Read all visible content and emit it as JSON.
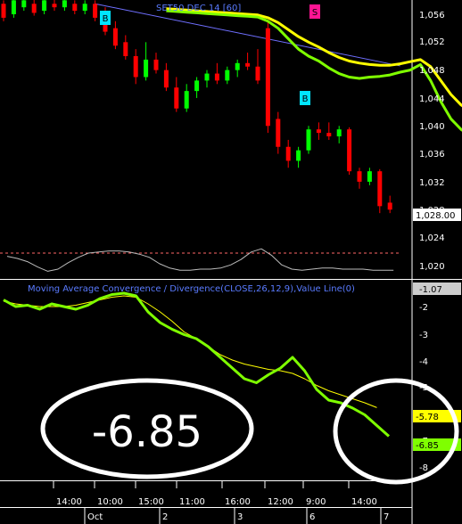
{
  "price_panel": {
    "title": "SET50 DEC 14  [60]",
    "y_ticks": [
      "1,056",
      "1,052",
      "1,048",
      "1,044",
      "1,040",
      "1,036",
      "1,032",
      "1,028",
      "1,024",
      "1,020"
    ],
    "last_value_label": "1,028.00",
    "markers": [
      {
        "text": "B",
        "kind": "buy",
        "color": "#00e5ff",
        "bar": 9
      },
      {
        "text": "B",
        "kind": "buy",
        "color": "#00e5ff",
        "bar": 25
      },
      {
        "text": "S",
        "kind": "sell",
        "color": "#ff1493",
        "bar": 26
      }
    ]
  },
  "oscillator_panel": {
    "value_label": "-1.07"
  },
  "macd_panel": {
    "title": "Moving Average Convergence / Divergence(CLOSE,26,12,9),Value Line(0)",
    "y_ticks": [
      "-2",
      "-3",
      "-4",
      "-5",
      "-6",
      "-7",
      "-8"
    ],
    "signal_label": "-5.78",
    "macd_label": "-6.85",
    "callout_text": "-6.85",
    "signal_color": "#ffff00",
    "macd_color": "#7fff00"
  },
  "time_axis": {
    "time_labels": [
      "14:00",
      "10:00",
      "15:00",
      "11:00",
      "16:00",
      "12:00",
      "9:00",
      "14:00"
    ],
    "date_labels": [
      "Oct",
      "2",
      "3",
      "6",
      "7"
    ]
  },
  "colors": {
    "up_candle": "#00ff00",
    "down_candle": "#ff0000",
    "ma_fast": "#7fff00",
    "ma_slow": "#ffff00",
    "trendline": "#6f6fff",
    "annotation": "#ffffff"
  },
  "chart_data": {
    "type": "candlestick",
    "bars": [
      {
        "o": 1057.5,
        "h": 1058.0,
        "l": 1055.0,
        "c": 1055.5
      },
      {
        "o": 1056.0,
        "h": 1058.5,
        "l": 1055.5,
        "c": 1058.0
      },
      {
        "o": 1057.0,
        "h": 1058.5,
        "l": 1056.5,
        "c": 1058.0
      },
      {
        "o": 1057.5,
        "h": 1058.5,
        "l": 1055.8,
        "c": 1056.2
      },
      {
        "o": 1056.5,
        "h": 1058.3,
        "l": 1056.0,
        "c": 1058.0
      },
      {
        "o": 1057.5,
        "h": 1058.5,
        "l": 1056.5,
        "c": 1057.0
      },
      {
        "o": 1057.0,
        "h": 1058.3,
        "l": 1056.5,
        "c": 1058.0
      },
      {
        "o": 1057.5,
        "h": 1058.0,
        "l": 1056.0,
        "c": 1056.5
      },
      {
        "o": 1056.5,
        "h": 1058.0,
        "l": 1056.0,
        "c": 1057.5
      },
      {
        "o": 1057.5,
        "h": 1058.0,
        "l": 1055.0,
        "c": 1055.5
      },
      {
        "o": 1056.0,
        "h": 1057.0,
        "l": 1053.0,
        "c": 1053.5
      },
      {
        "o": 1054.0,
        "h": 1055.0,
        "l": 1051.0,
        "c": 1051.5
      },
      {
        "o": 1052.0,
        "h": 1053.0,
        "l": 1049.5,
        "c": 1050.0
      },
      {
        "o": 1050.0,
        "h": 1051.0,
        "l": 1046.0,
        "c": 1047.0
      },
      {
        "o": 1047.0,
        "h": 1052.0,
        "l": 1046.5,
        "c": 1049.5
      },
      {
        "o": 1049.5,
        "h": 1050.5,
        "l": 1047.5,
        "c": 1048.0
      },
      {
        "o": 1048.0,
        "h": 1049.0,
        "l": 1045.0,
        "c": 1045.5
      },
      {
        "o": 1045.5,
        "h": 1047.0,
        "l": 1042.0,
        "c": 1042.5
      },
      {
        "o": 1042.5,
        "h": 1046.0,
        "l": 1042.0,
        "c": 1045.0
      },
      {
        "o": 1045.0,
        "h": 1047.0,
        "l": 1044.0,
        "c": 1046.5
      },
      {
        "o": 1046.5,
        "h": 1048.0,
        "l": 1045.5,
        "c": 1047.5
      },
      {
        "o": 1047.5,
        "h": 1049.0,
        "l": 1046.0,
        "c": 1046.5
      },
      {
        "o": 1046.5,
        "h": 1048.5,
        "l": 1046.0,
        "c": 1048.0
      },
      {
        "o": 1048.0,
        "h": 1049.5,
        "l": 1047.0,
        "c": 1049.0
      },
      {
        "o": 1049.0,
        "h": 1050.5,
        "l": 1048.0,
        "c": 1048.5
      },
      {
        "o": 1048.5,
        "h": 1051.0,
        "l": 1046.0,
        "c": 1046.5
      },
      {
        "o": 1054.0,
        "h": 1055.0,
        "l": 1039.0,
        "c": 1040.0
      },
      {
        "o": 1041.0,
        "h": 1042.0,
        "l": 1036.0,
        "c": 1037.0
      },
      {
        "o": 1037.0,
        "h": 1038.0,
        "l": 1034.0,
        "c": 1035.0
      },
      {
        "o": 1035.0,
        "h": 1037.0,
        "l": 1034.0,
        "c": 1036.5
      },
      {
        "o": 1036.5,
        "h": 1040.0,
        "l": 1036.0,
        "c": 1039.5
      },
      {
        "o": 1039.5,
        "h": 1040.5,
        "l": 1038.0,
        "c": 1039.0
      },
      {
        "o": 1039.0,
        "h": 1040.5,
        "l": 1038.0,
        "c": 1038.5
      },
      {
        "o": 1038.5,
        "h": 1040.0,
        "l": 1037.5,
        "c": 1039.5
      },
      {
        "o": 1039.5,
        "h": 1039.8,
        "l": 1033.0,
        "c": 1033.5
      },
      {
        "o": 1033.5,
        "h": 1034.0,
        "l": 1031.0,
        "c": 1032.0
      },
      {
        "o": 1032.0,
        "h": 1034.0,
        "l": 1031.5,
        "c": 1033.5
      },
      {
        "o": 1033.5,
        "h": 1033.8,
        "l": 1027.5,
        "c": 1028.5
      },
      {
        "o": 1029.0,
        "h": 1030.0,
        "l": 1027.5,
        "c": 1028.0
      }
    ],
    "ma_fast": [
      1056.5,
      1056.4,
      1056.3,
      1056.2,
      1056.1,
      1056.0,
      1055.9,
      1055.8,
      1055.7,
      1055.6,
      1055.0,
      1054.0,
      1052.5,
      1051.0,
      1050.0,
      1049.3,
      1048.3,
      1047.5,
      1047.0,
      1046.8,
      1047.0,
      1047.1,
      1047.3,
      1047.7,
      1048.0,
      1048.8,
      1046.5,
      1043.5,
      1041.0,
      1039.5,
      1038.5,
      1038.0,
      1037.8,
      1037.6,
      1036.5,
      1035.5,
      1034.8,
      1032.5,
      1031.0
    ],
    "ma_slow": [
      1056.8,
      1056.7,
      1056.6,
      1056.5,
      1056.4,
      1056.3,
      1056.2,
      1056.1,
      1056.0,
      1055.9,
      1055.5,
      1054.8,
      1053.8,
      1052.8,
      1052.0,
      1051.3,
      1050.5,
      1049.8,
      1049.3,
      1049.0,
      1048.8,
      1048.7,
      1048.7,
      1048.9,
      1049.2,
      1049.5,
      1048.5,
      1046.5,
      1044.5,
      1043.0,
      1042.0,
      1041.2,
      1040.7,
      1040.3,
      1039.3,
      1038.3,
      1037.4,
      1036.5,
      1035.3
    ],
    "trendline": [
      [
        9,
        1057.5
      ],
      [
        39,
        1048.6
      ]
    ],
    "oscillator": [
      0.2,
      0.0,
      -0.3,
      -0.8,
      -1.2,
      -1.0,
      -0.4,
      0.1,
      0.5,
      0.6,
      0.7,
      0.7,
      0.6,
      0.4,
      0.1,
      -0.5,
      -0.9,
      -1.1,
      -1.1,
      -1.0,
      -1.0,
      -0.9,
      -0.6,
      -0.1,
      0.6,
      0.9,
      0.3,
      -0.6,
      -1.0,
      -1.1,
      -1.0,
      -0.9,
      -0.9,
      -1.0,
      -1.0,
      -1.0,
      -1.1,
      -1.1,
      -1.1
    ],
    "macd": [
      -1.75,
      -2.0,
      -1.95,
      -2.1,
      -1.9,
      -2.0,
      -2.1,
      -1.95,
      -1.7,
      -1.55,
      -1.5,
      -1.6,
      -2.2,
      -2.6,
      -2.85,
      -3.05,
      -3.2,
      -3.5,
      -3.9,
      -4.3,
      -4.7,
      -4.85,
      -4.55,
      -4.3,
      -3.9,
      -4.4,
      -5.1,
      -5.5,
      -5.6,
      -5.8,
      -6.05,
      -6.45,
      -6.85
    ],
    "signal": [
      -1.8,
      -1.9,
      -1.95,
      -2.0,
      -2.0,
      -2.0,
      -1.95,
      -1.85,
      -1.75,
      -1.65,
      -1.6,
      -1.65,
      -1.9,
      -2.2,
      -2.55,
      -2.95,
      -3.2,
      -3.5,
      -3.8,
      -4.0,
      -4.15,
      -4.25,
      -4.35,
      -4.4,
      -4.5,
      -4.7,
      -4.95,
      -5.15,
      -5.3,
      -5.45,
      -5.6,
      -5.78
    ]
  }
}
